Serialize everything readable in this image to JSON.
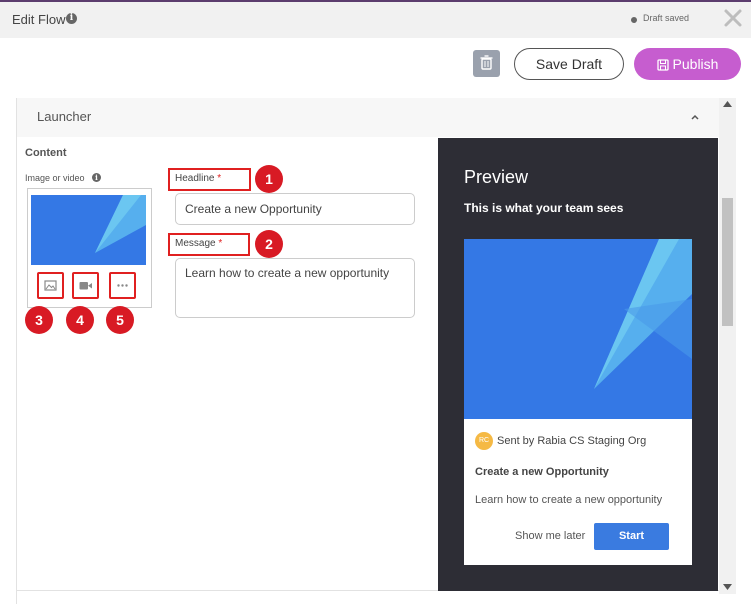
{
  "header": {
    "title": "Edit Flow",
    "status": "Draft saved"
  },
  "toolbar": {
    "delete_icon": "trash-icon",
    "save_label": "Save Draft",
    "publish_label": "Publish",
    "publish_icon": "save-icon",
    "publish_color": "#c65dcf"
  },
  "section": {
    "title": "Launcher",
    "collapse_icon": "chevron-up-icon"
  },
  "content": {
    "heading": "Content",
    "media_label": "Image or video",
    "media_buttons": [
      "image-icon",
      "video-icon",
      "more-icon"
    ],
    "headline_label": "Headline",
    "headline_value": "Create a new Opportunity",
    "message_label": "Message",
    "message_value": "Learn how to create a new opportunity",
    "required_mark": "*"
  },
  "annotations": [
    "1",
    "2",
    "3",
    "4",
    "5"
  ],
  "preview": {
    "title": "Preview",
    "subtitle": "This is what your team sees",
    "avatar_initials": "RC",
    "sender": "Sent by Rabia CS Staging Org",
    "headline": "Create a new Opportunity",
    "message": "Learn how to create a new opportunity",
    "later_label": "Show me later",
    "start_label": "Start",
    "background": "#2d2d35",
    "accent": "#3a7be0"
  }
}
